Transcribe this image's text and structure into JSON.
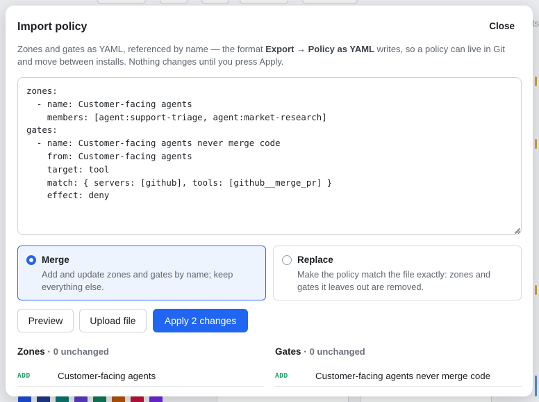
{
  "backdrop": {
    "partial_text": "ts",
    "swatch_colors": [
      "#1d4ed8",
      "#1e3a8a",
      "#0f766e",
      "#5b3cc4",
      "#0f7a5a",
      "#b45309",
      "#be123c",
      "#6d28d9"
    ]
  },
  "modal": {
    "title": "Import policy",
    "close_label": "Close",
    "description": {
      "part1": "Zones and gates as YAML, referenced by name — the format ",
      "emphasis": "Export → Policy as YAML",
      "part2": " writes, so a policy can live in Git and move between installs. Nothing changes until you press Apply."
    },
    "yaml_value": "zones:\n  - name: Customer-facing agents\n    members: [agent:support-triage, agent:market-research]\ngates:\n  - name: Customer-facing agents never merge code\n    from: Customer-facing agents\n    target: tool\n    match: { servers: [github], tools: [github__merge_pr] }\n    effect: deny",
    "options": [
      {
        "title": "Merge",
        "description": "Add and update zones and gates by name; keep everything else.",
        "selected": true
      },
      {
        "title": "Replace",
        "description": "Make the policy match the file exactly: zones and gates it leaves out are removed.",
        "selected": false
      }
    ],
    "buttons": {
      "preview": "Preview",
      "upload": "Upload file",
      "apply": "Apply 2 changes"
    },
    "accent_color": "#2166f3",
    "zones": {
      "heading": "Zones",
      "separator": "·",
      "count": "0 unchanged",
      "rows": [
        {
          "tag": "ADD",
          "name": "Customer-facing agents"
        }
      ]
    },
    "gates": {
      "heading": "Gates",
      "separator": "·",
      "count": "0 unchanged",
      "rows": [
        {
          "tag": "ADD",
          "name": "Customer-facing agents never merge code"
        }
      ]
    }
  }
}
